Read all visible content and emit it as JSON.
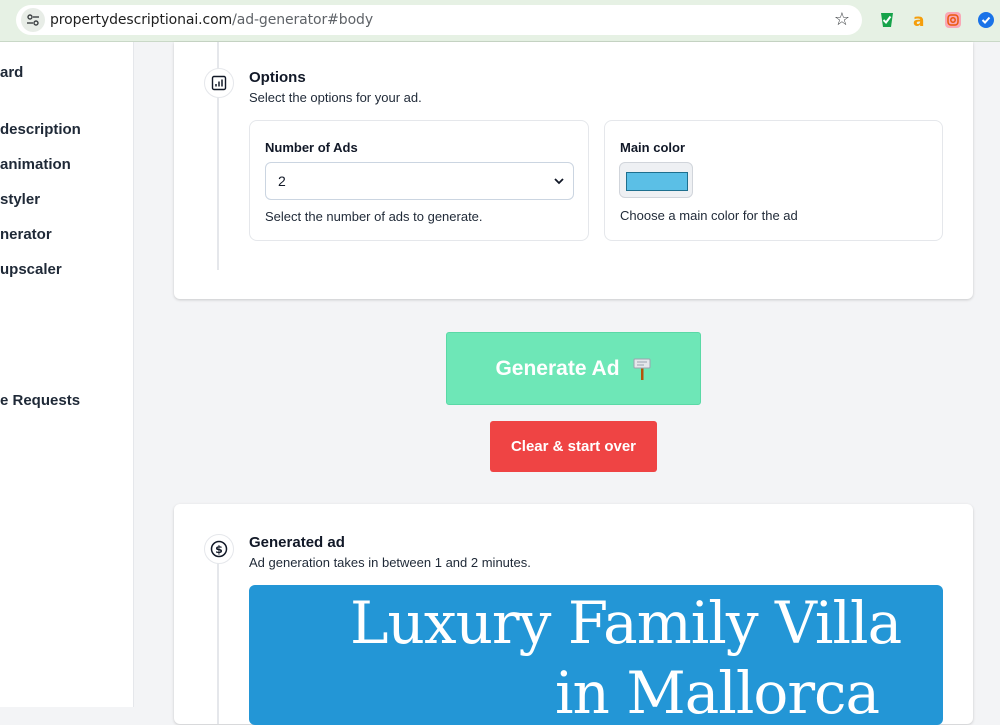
{
  "browser": {
    "url_domain": "propertydescriptionai.com",
    "url_path": "/ad-generator#body"
  },
  "sidebar": {
    "items": [
      {
        "label": "ard"
      },
      {
        "label": " description"
      },
      {
        "label": "animation"
      },
      {
        "label": "styler"
      },
      {
        "label": "nerator"
      },
      {
        "label": "upscaler"
      },
      {
        "label": "e Requests"
      }
    ]
  },
  "options": {
    "title": "Options",
    "subtitle": "Select the options for your ad.",
    "num_ads": {
      "label": "Number of Ads",
      "value": "2",
      "help": "Select the number of ads to generate."
    },
    "main_color": {
      "label": "Main color",
      "value": "#5bbfe6",
      "help": "Choose a main color for the ad"
    }
  },
  "actions": {
    "generate_label": "Generate Ad",
    "clear_label": "Clear & start over"
  },
  "generated": {
    "title": "Generated ad",
    "subtitle": "Ad generation takes in between 1 and 2 minutes.",
    "ad_title_line1": "Luxury Family Villa",
    "ad_title_line2": "in Mallorca",
    "ad_background": "#2396d6"
  },
  "colors": {
    "generate_button": "#6ee7b7",
    "clear_button": "#ef4444"
  }
}
